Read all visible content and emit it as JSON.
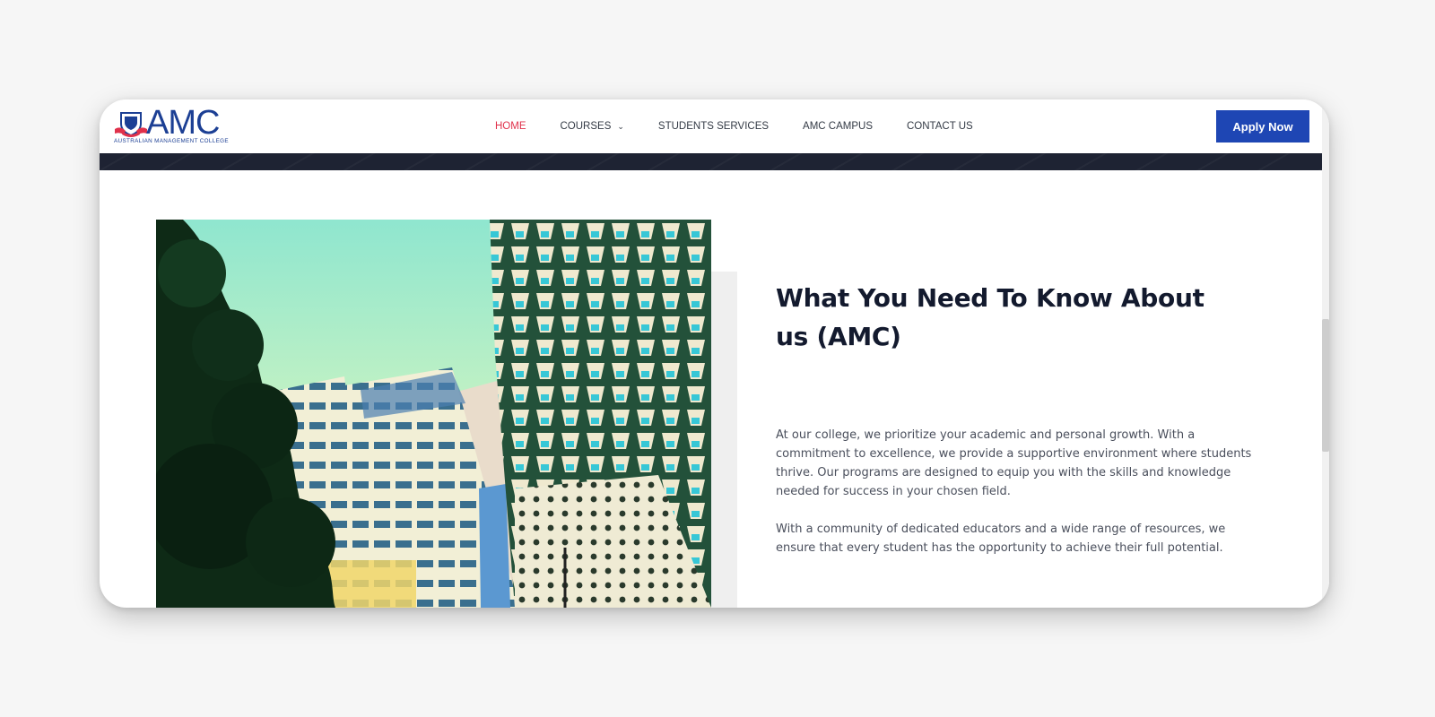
{
  "brand": {
    "name": "AMC",
    "subtitle": "AUSTRALIAN MANAGEMENT COLLEGE",
    "primary_color": "#1c3f94",
    "accent_color": "#e0314b"
  },
  "nav": {
    "items": [
      {
        "label": "HOME",
        "active": true
      },
      {
        "label": "COURSES",
        "has_dropdown": true
      },
      {
        "label": "STUDENTS SERVICES"
      },
      {
        "label": "AMC CAMPUS"
      },
      {
        "label": "CONTACT US"
      }
    ],
    "apply_label": "Apply Now",
    "apply_color": "#1e46b4"
  },
  "about": {
    "title": "What You Need To Know About us (AMC)",
    "paragraphs": [
      "At our college, we prioritize your academic and personal growth. With a commitment to excellence, we provide a supportive environment where students thrive. Our programs are designed to equip you with the skills and knowledge needed for success in your chosen field.",
      "With a community of dedicated educators and a wide range of resources, we ensure that every student has the opportunity to achieve their full potential."
    ],
    "image": "campus-buildings-photo"
  }
}
